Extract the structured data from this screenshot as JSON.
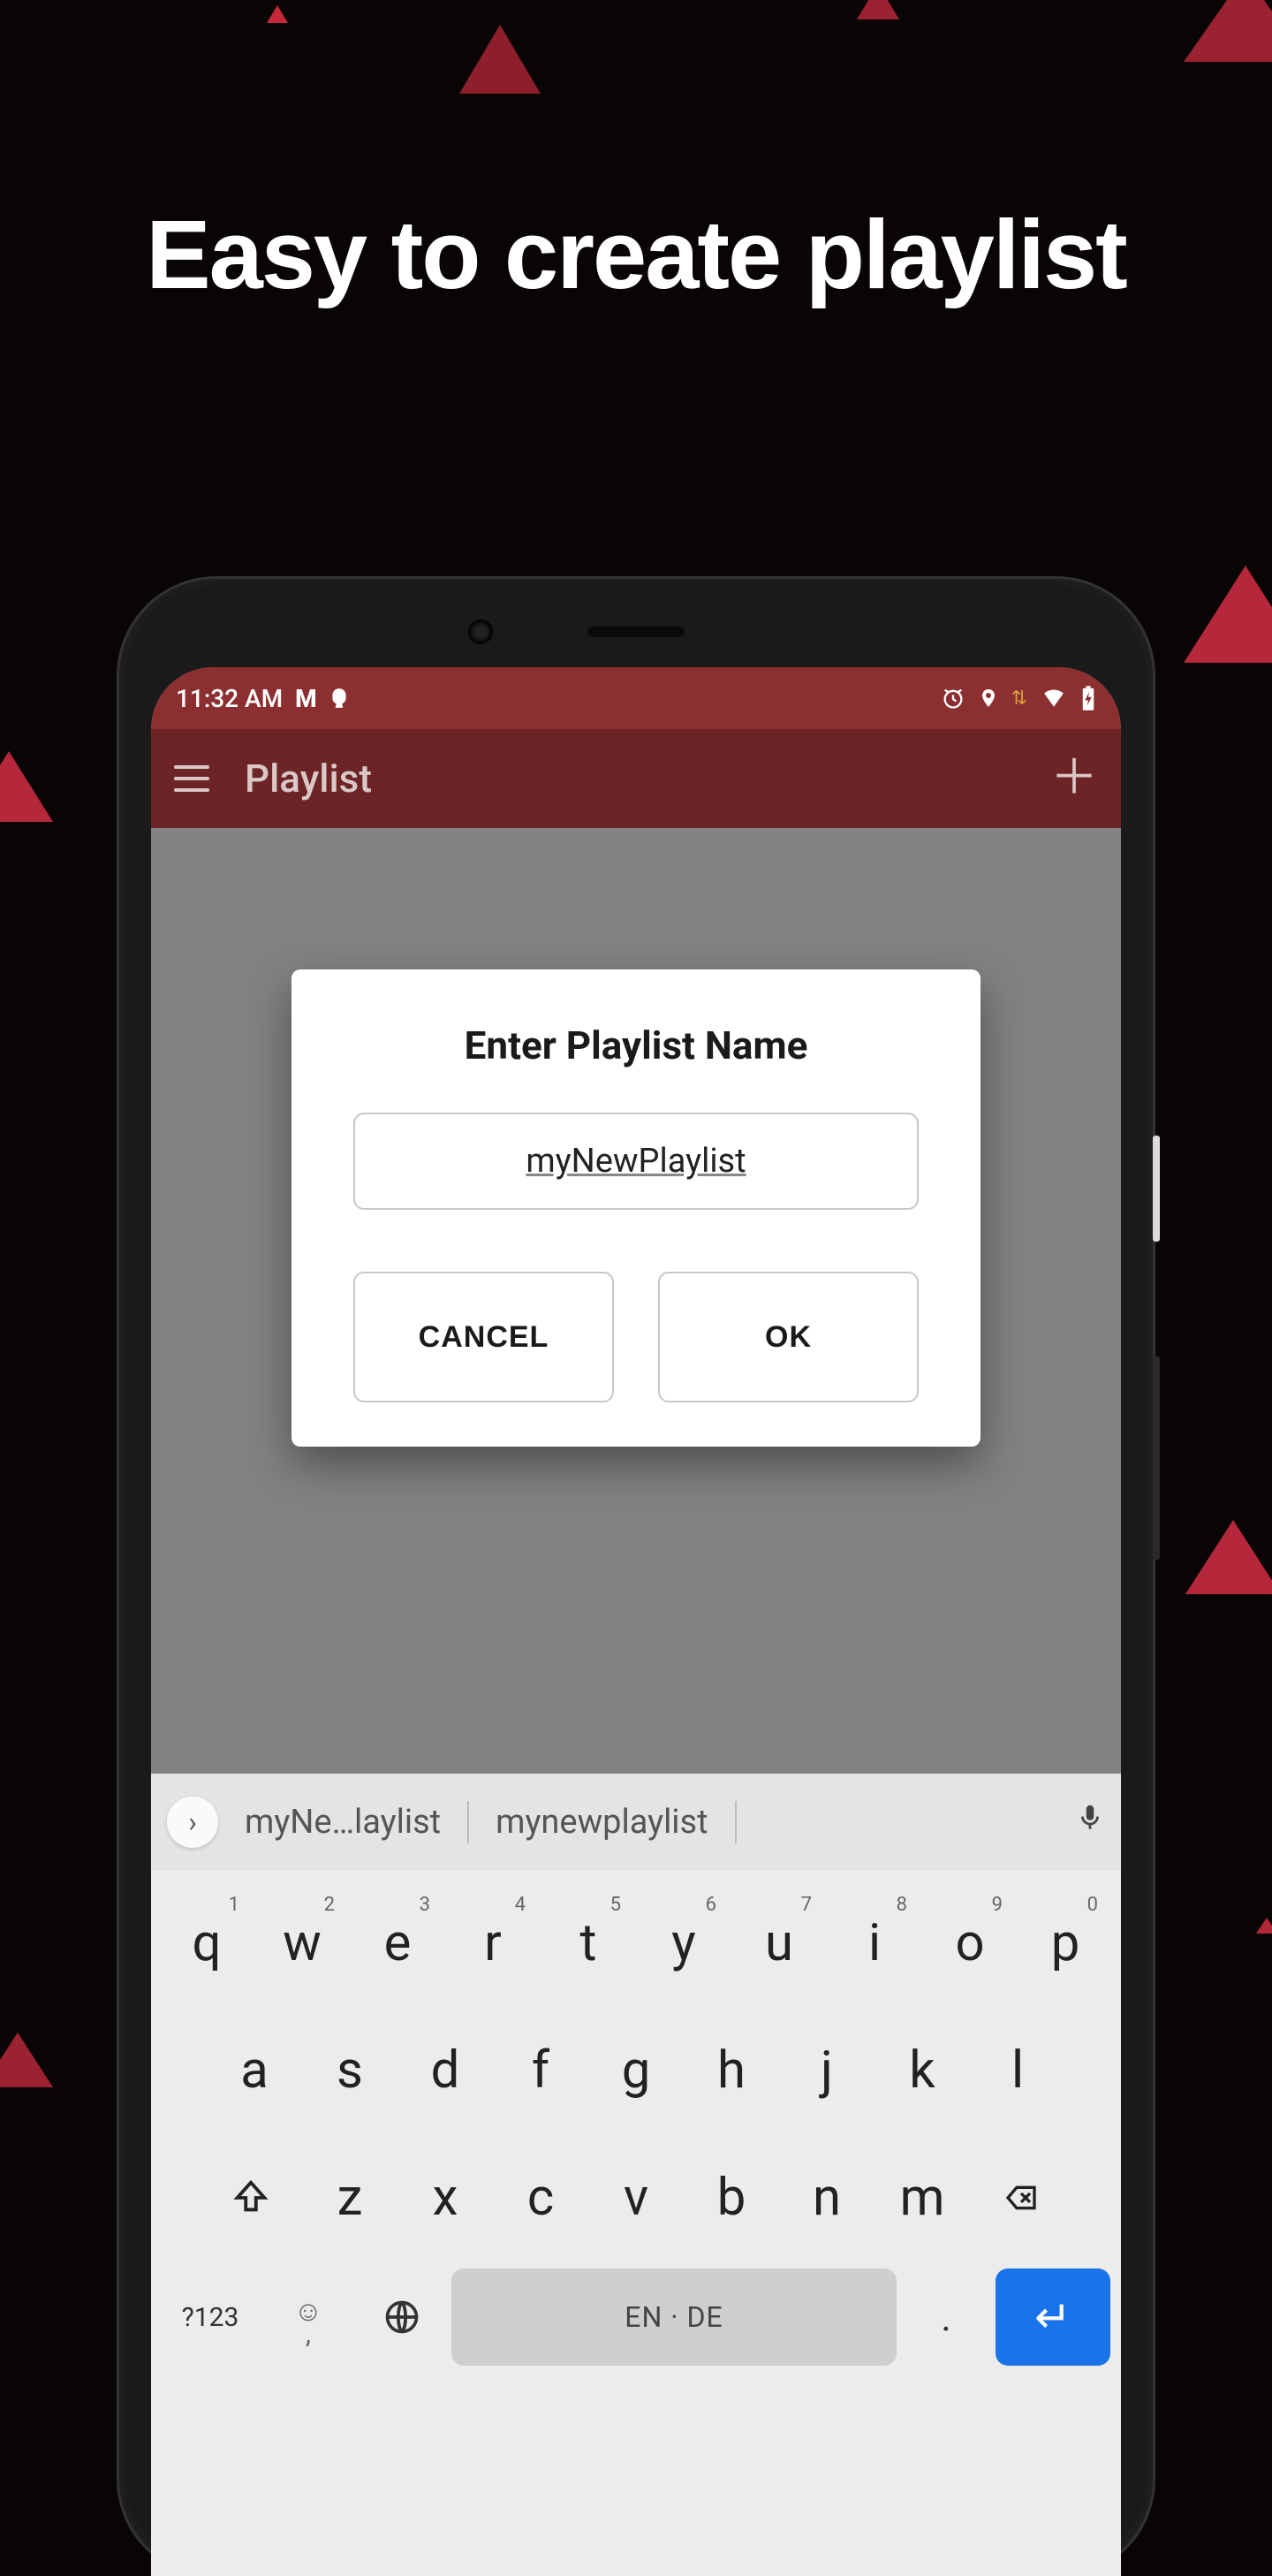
{
  "headline": "Easy to create playlist",
  "status": {
    "time": "11:32 AM"
  },
  "appbar": {
    "title": "Playlist"
  },
  "dialog": {
    "title": "Enter Playlist Name",
    "input_value": "myNewPlaylist",
    "cancel": "CANCEL",
    "ok": "OK"
  },
  "keyboard": {
    "suggestions": [
      "myNe…laylist",
      "mynewplaylist"
    ],
    "row1": [
      {
        "k": "q",
        "n": "1"
      },
      {
        "k": "w",
        "n": "2"
      },
      {
        "k": "e",
        "n": "3"
      },
      {
        "k": "r",
        "n": "4"
      },
      {
        "k": "t",
        "n": "5"
      },
      {
        "k": "y",
        "n": "6"
      },
      {
        "k": "u",
        "n": "7"
      },
      {
        "k": "i",
        "n": "8"
      },
      {
        "k": "o",
        "n": "9"
      },
      {
        "k": "p",
        "n": "0"
      }
    ],
    "row2": [
      "a",
      "s",
      "d",
      "f",
      "g",
      "h",
      "j",
      "k",
      "l"
    ],
    "row3": [
      "z",
      "x",
      "c",
      "v",
      "b",
      "n",
      "m"
    ],
    "symbols_label": "?123",
    "space_label": "EN · DE"
  }
}
